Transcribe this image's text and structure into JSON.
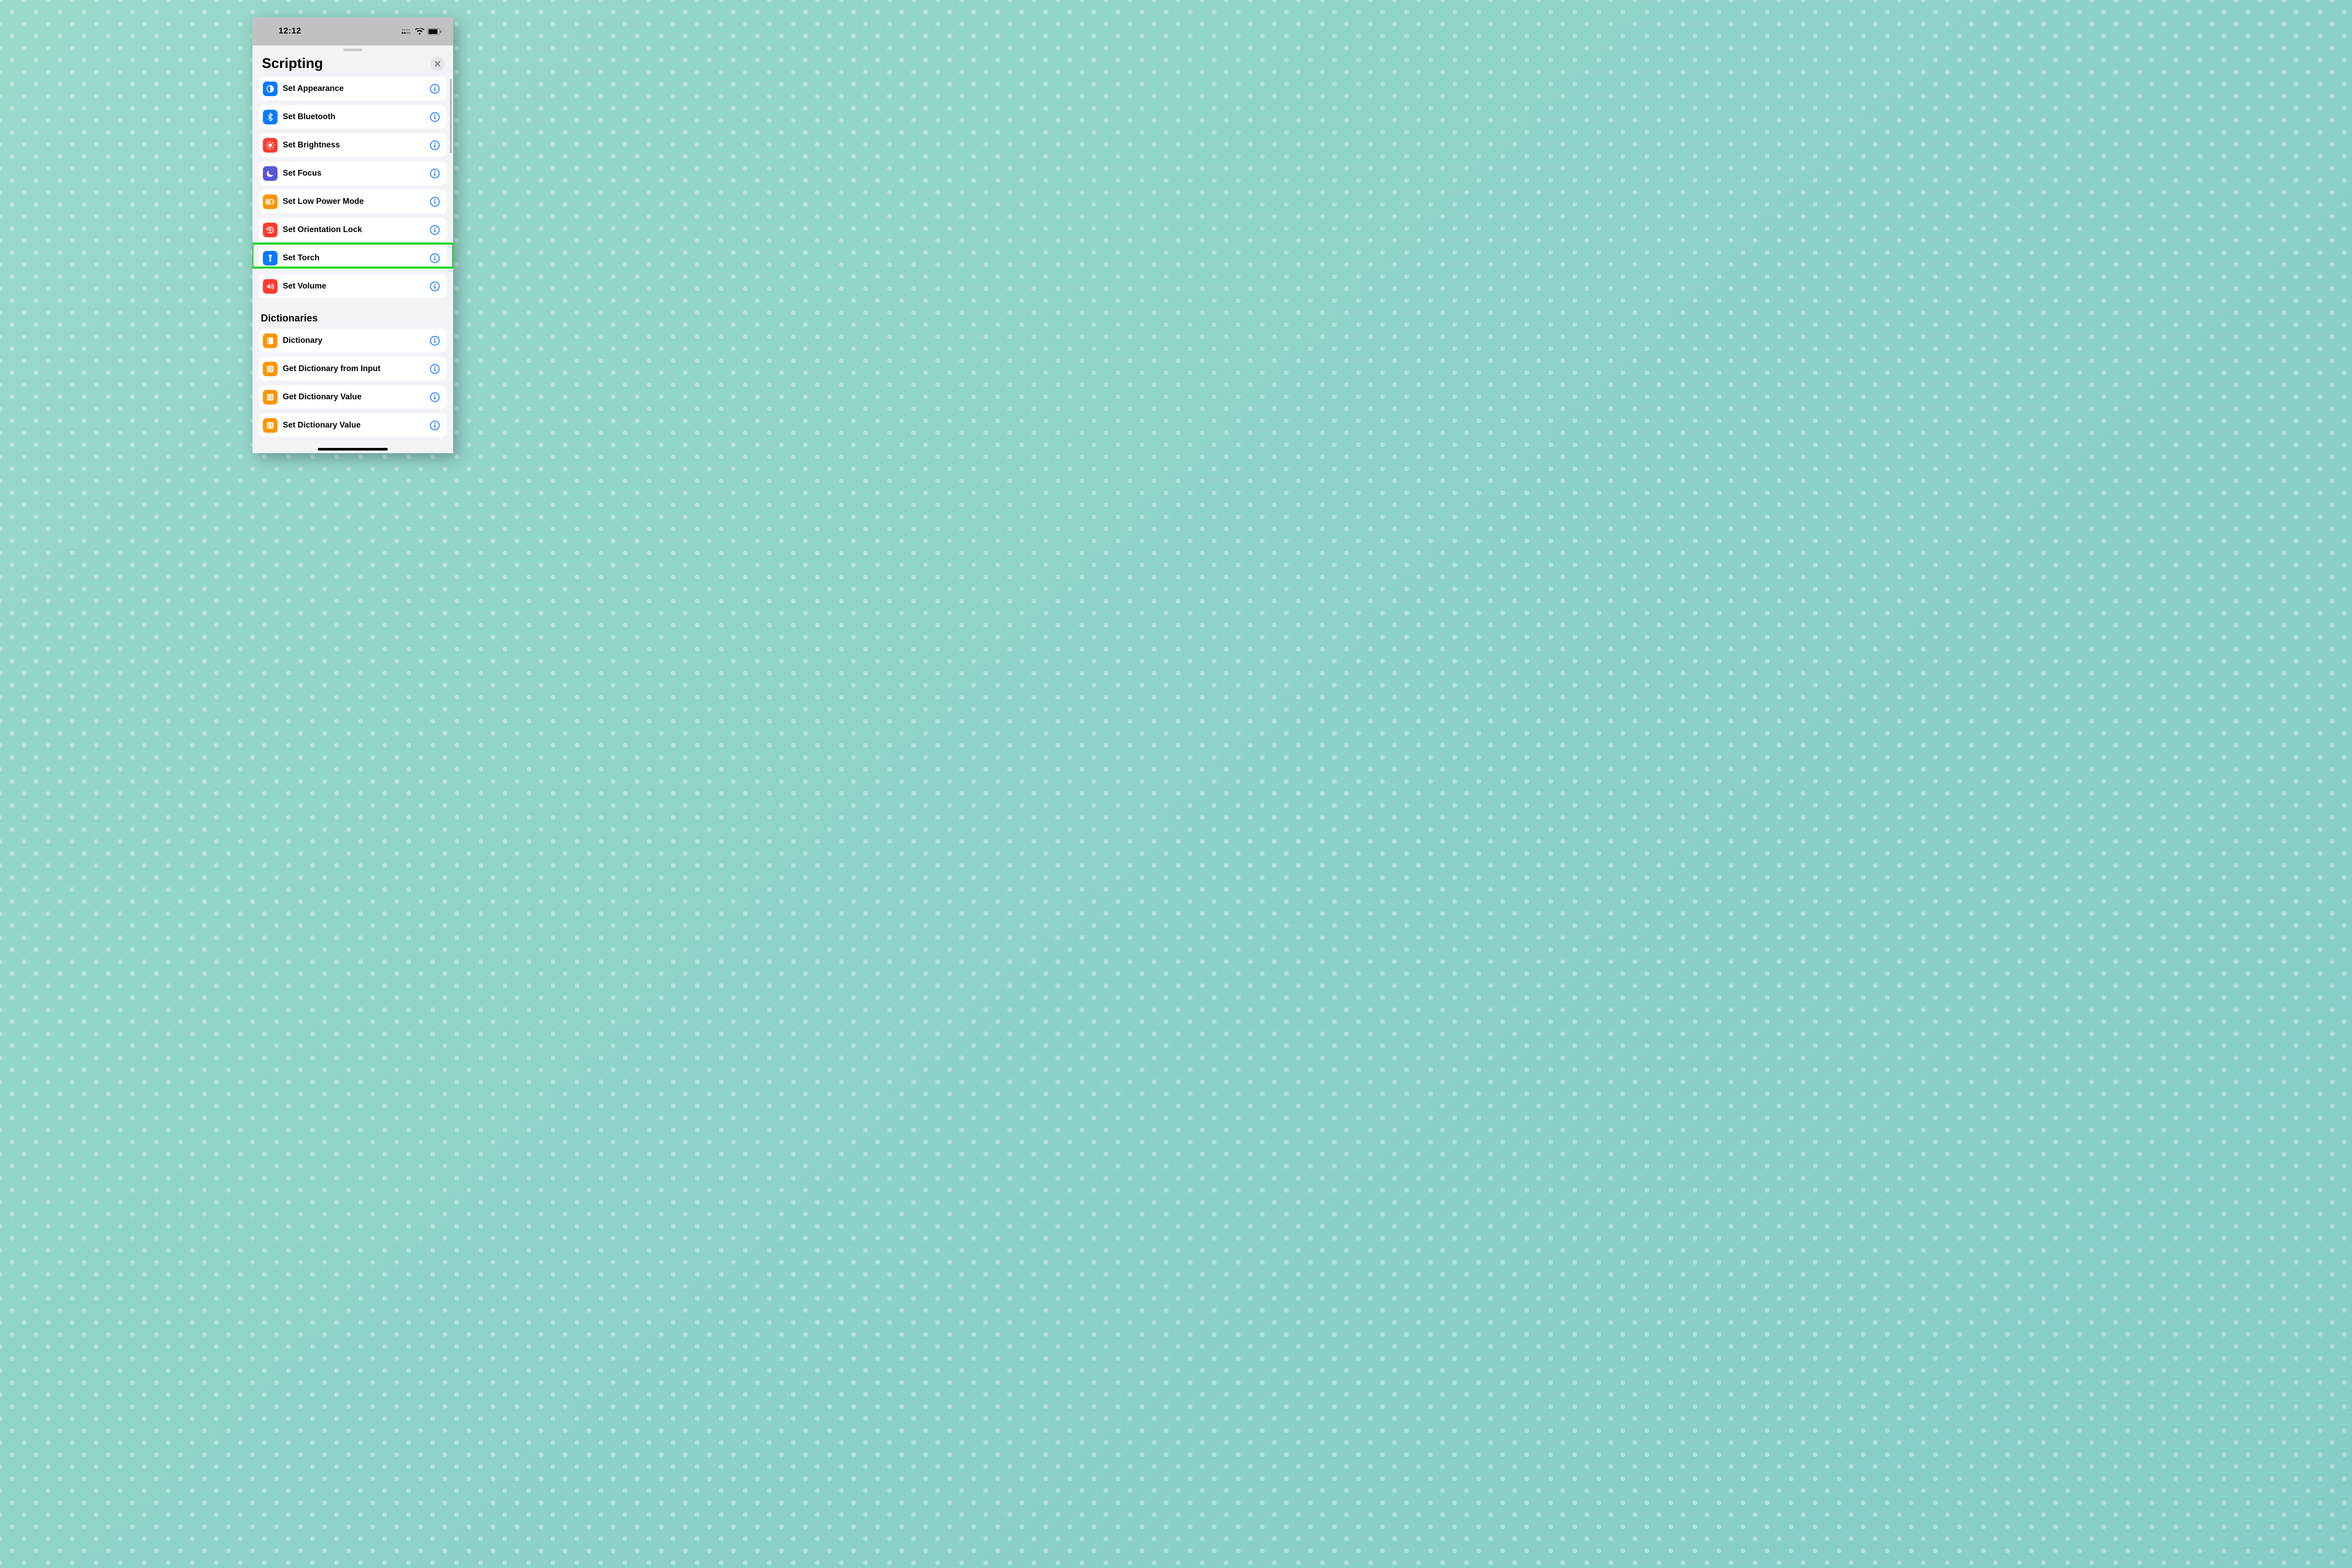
{
  "statusbar": {
    "time": "12:12"
  },
  "sheet": {
    "title": "Scripting"
  },
  "section1": {
    "items": [
      {
        "label": "Set Appearance",
        "icon": "appearance",
        "color": "blue"
      },
      {
        "label": "Set Bluetooth",
        "icon": "bluetooth",
        "color": "blue"
      },
      {
        "label": "Set Brightness",
        "icon": "brightness",
        "color": "red"
      },
      {
        "label": "Set Focus",
        "icon": "moon",
        "color": "purple"
      },
      {
        "label": "Set Low Power Mode",
        "icon": "lowpower",
        "color": "orange"
      },
      {
        "label": "Set Orientation Lock",
        "icon": "orientation",
        "color": "red"
      },
      {
        "label": "Set Torch",
        "icon": "torch",
        "color": "blue",
        "highlighted": true
      },
      {
        "label": "Set Volume",
        "icon": "volume",
        "color": "red"
      }
    ]
  },
  "section2": {
    "header": "Dictionaries",
    "items": [
      {
        "label": "Dictionary",
        "icon": "book",
        "color": "orange"
      },
      {
        "label": "Get Dictionary from Input",
        "icon": "dict-get",
        "color": "orange"
      },
      {
        "label": "Get Dictionary Value",
        "icon": "dict-get",
        "color": "orange"
      },
      {
        "label": "Set Dictionary Value",
        "icon": "dict-set",
        "color": "orange"
      }
    ]
  },
  "colors": {
    "highlight": "#1fd61f",
    "info": "#0a7aff"
  }
}
